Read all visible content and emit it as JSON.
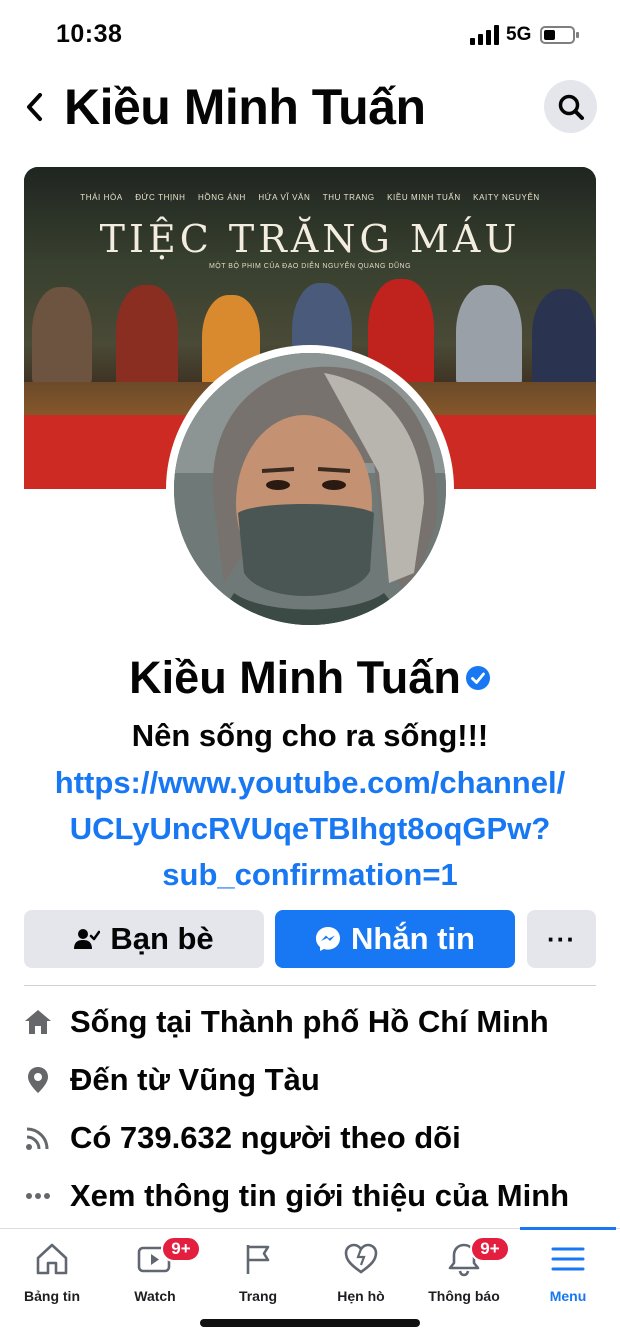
{
  "status_bar": {
    "time": "10:38",
    "network": "5G",
    "icons": [
      "cellular-signal-icon",
      "battery-icon"
    ]
  },
  "header": {
    "back_icon": "chevron-left-icon",
    "title": "Kiều Minh Tuấn",
    "search_icon": "search-icon"
  },
  "cover": {
    "cast_names": [
      "THÁI HÒA",
      "ĐỨC THỊNH",
      "HỒNG ÁNH",
      "HỨA VĨ VĂN",
      "THU TRANG",
      "KIỀU MINH TUẤN",
      "KAITY NGUYỄN"
    ],
    "movie_title": "TIỆC TRĂNG MÁU",
    "subtitle": "MỘT BỘ PHIM CỦA ĐẠO DIỄN NGUYỄN QUANG DŨNG"
  },
  "profile": {
    "name": "Kiều Minh Tuấn",
    "verified_icon": "verified-badge-icon",
    "bio": "Nên sống cho ra sống!!!",
    "link_lines": [
      "https://www.youtube.com/channel/",
      "UCLyUncRVUqeTBIhgt8oqGPw?",
      "sub_confirmation=1"
    ]
  },
  "actions": {
    "friends_label": "Bạn bè",
    "message_label": "Nhắn tin",
    "more_label": "···"
  },
  "info": {
    "items": [
      {
        "icon": "home-icon",
        "text": "Sống tại Thành phố Hồ Chí Minh"
      },
      {
        "icon": "location-pin-icon",
        "text": "Đến từ Vũng Tàu"
      },
      {
        "icon": "rss-followers-icon",
        "text": "Có 739.632 người theo dõi"
      },
      {
        "icon": "more-dots-icon",
        "text": "Xem thông tin giới thiệu của Minh"
      }
    ]
  },
  "bottom_nav": {
    "items": [
      {
        "label": "Bảng tin",
        "icon": "home-icon"
      },
      {
        "label": "Watch",
        "icon": "watch-video-icon",
        "badge": "9+"
      },
      {
        "label": "Trang",
        "icon": "flag-icon"
      },
      {
        "label": "Hẹn hò",
        "icon": "dating-heart-icon"
      },
      {
        "label": "Thông báo",
        "icon": "bell-icon",
        "badge": "9+"
      },
      {
        "label": "Menu",
        "icon": "menu-hamburger-icon"
      }
    ],
    "active_index": 5
  },
  "colors": {
    "accent": "#1877f2",
    "badge": "#e41e3f",
    "button_gray": "#e4e6eb",
    "cover_red": "#cc2a22"
  }
}
